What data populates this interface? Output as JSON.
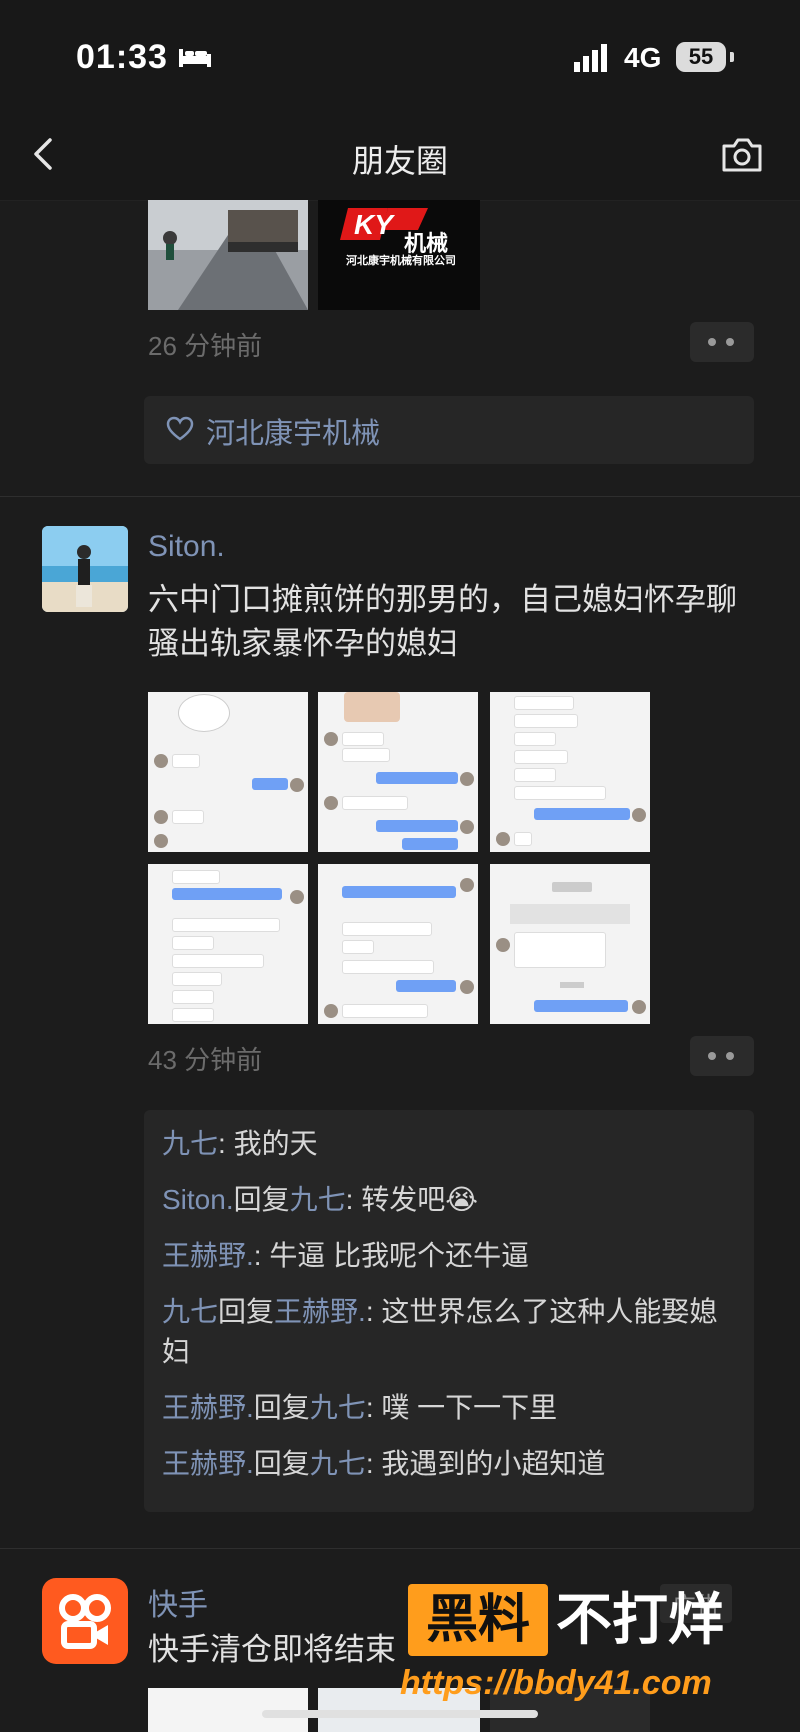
{
  "status": {
    "time": "01:33",
    "network": "4G",
    "battery": "55"
  },
  "nav": {
    "title": "朋友圈"
  },
  "post1": {
    "logo_text": "机械",
    "logo_company": "河北康宇机械有限公司",
    "time": "26 分钟前",
    "likes": "河北康宇机械"
  },
  "post2": {
    "name": "Siton.",
    "text": "六中门口摊煎饼的那男的，自己媳妇怀孕聊骚出轨家暴怀孕的媳妇",
    "time": "43 分钟前",
    "comments": [
      {
        "name": "九七",
        "sep": ": ",
        "text": "我的天"
      },
      {
        "name": "Siton.",
        "mid": "回复",
        "target": "九七",
        "sep": ": ",
        "text": "转发吧😭"
      },
      {
        "name": "王赫野.",
        "sep": ": ",
        "text": "牛逼 比我呢个还牛逼"
      },
      {
        "name": "九七",
        "mid": "回复",
        "target": "王赫野.",
        "sep": ": ",
        "text": "这世界怎么了这种人能娶媳妇"
      },
      {
        "name": "王赫野.",
        "mid": "回复",
        "target": "九七",
        "sep": ": ",
        "text": "噗 一下一下里"
      },
      {
        "name": "王赫野.",
        "mid": "回复",
        "target": "九七",
        "sep": ": ",
        "text": "我遇到的小超知道"
      }
    ]
  },
  "post3": {
    "name": "快手",
    "text": "快手清仓即将结束",
    "ad_label": "广告"
  },
  "watermark": {
    "part1": "黑料",
    "part2": "不打烊",
    "url": "https://bbdy41.com"
  },
  "colors": {
    "background": "#1c1c1c",
    "name_blue": "#7f93b6",
    "kuaishou_orange": "#ff5a1f",
    "watermark_orange": "#ff9d1c"
  }
}
